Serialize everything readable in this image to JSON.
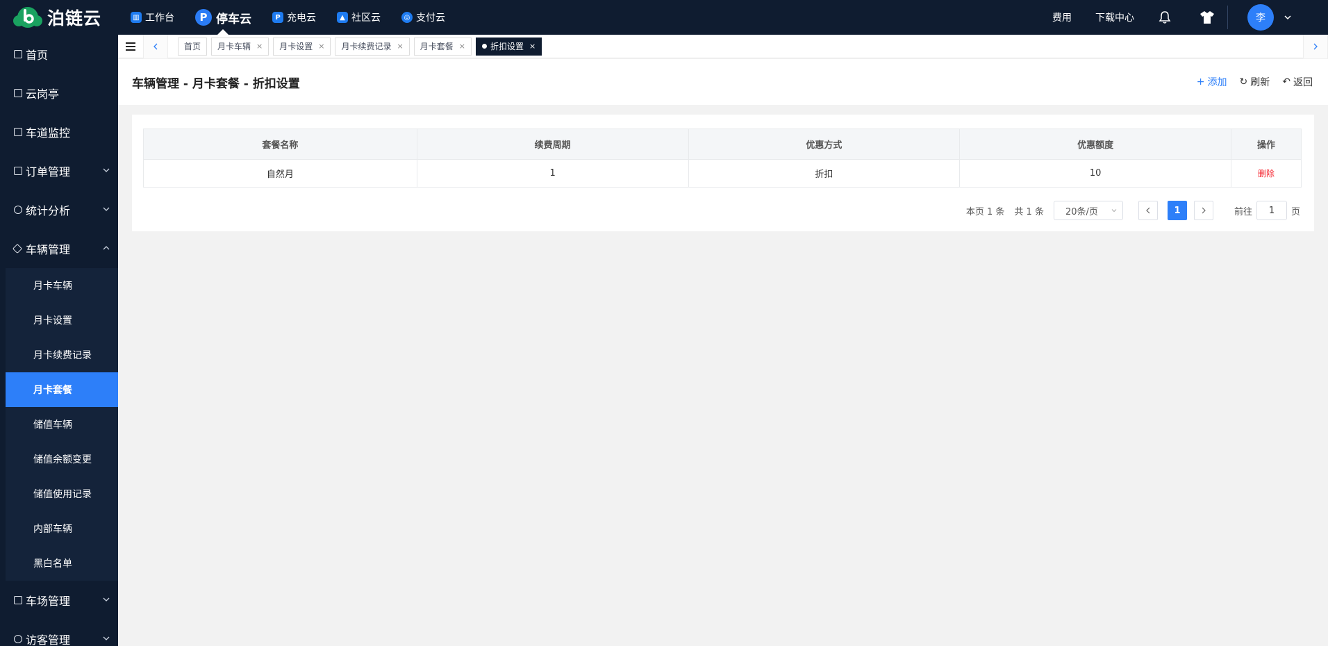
{
  "brand": {
    "name": "泊链云"
  },
  "topnav": [
    {
      "label": "工作台",
      "icon": "dashboard-icon"
    },
    {
      "label": "停车云",
      "icon": "parking-icon",
      "active": true
    },
    {
      "label": "充电云",
      "icon": "charging-icon"
    },
    {
      "label": "社区云",
      "icon": "community-icon"
    },
    {
      "label": "支付云",
      "icon": "payment-icon"
    }
  ],
  "top_right": {
    "fees": "费用",
    "download": "下载中心",
    "avatar_text": "李"
  },
  "sidebar": {
    "items": [
      {
        "label": "首页",
        "icon": "home-icon"
      },
      {
        "label": "云岗亭",
        "icon": "booth-icon"
      },
      {
        "label": "车道监控",
        "icon": "monitor-icon"
      },
      {
        "label": "订单管理",
        "icon": "order-icon"
      },
      {
        "label": "统计分析",
        "icon": "stats-icon"
      },
      {
        "label": "车辆管理",
        "icon": "vehicle-icon",
        "expanded": true
      }
    ],
    "sub_items": [
      "月卡车辆",
      "月卡设置",
      "月卡续费记录",
      "月卡套餐",
      "储值车辆",
      "储值余额变更",
      "储值使用记录",
      "内部车辆",
      "黑白名单"
    ],
    "active_sub": "月卡套餐",
    "after_items": [
      {
        "label": "车场管理",
        "icon": "lot-icon"
      },
      {
        "label": "访客管理",
        "icon": "visitor-icon"
      }
    ]
  },
  "tabs": [
    {
      "label": "首页"
    },
    {
      "label": "月卡车辆"
    },
    {
      "label": "月卡设置"
    },
    {
      "label": "月卡续费记录"
    },
    {
      "label": "月卡套餐"
    },
    {
      "label": "折扣设置",
      "active": true
    }
  ],
  "page": {
    "title": "车辆管理 - 月卡套餐 - 折扣设置",
    "actions": {
      "add": "添加",
      "refresh": "刷新",
      "back": "返回"
    }
  },
  "table": {
    "columns": [
      "套餐名称",
      "续费周期",
      "优惠方式",
      "优惠额度",
      "操作"
    ],
    "rows": [
      {
        "name": "自然月",
        "cycle": "1",
        "method": "折扣",
        "amount": "10",
        "action": "删除"
      }
    ]
  },
  "pagination": {
    "page_count_text": "本页 1 条",
    "total_text": "共 1 条",
    "page_size": "20条/页",
    "current_page": "1",
    "goto_label": "前往",
    "goto_value": "1",
    "page_suffix": "页"
  },
  "colors": {
    "nav_bg": "#0f1c30",
    "accent": "#2d7ff9",
    "danger": "#f5222d",
    "brand_green": "#1aa260"
  }
}
